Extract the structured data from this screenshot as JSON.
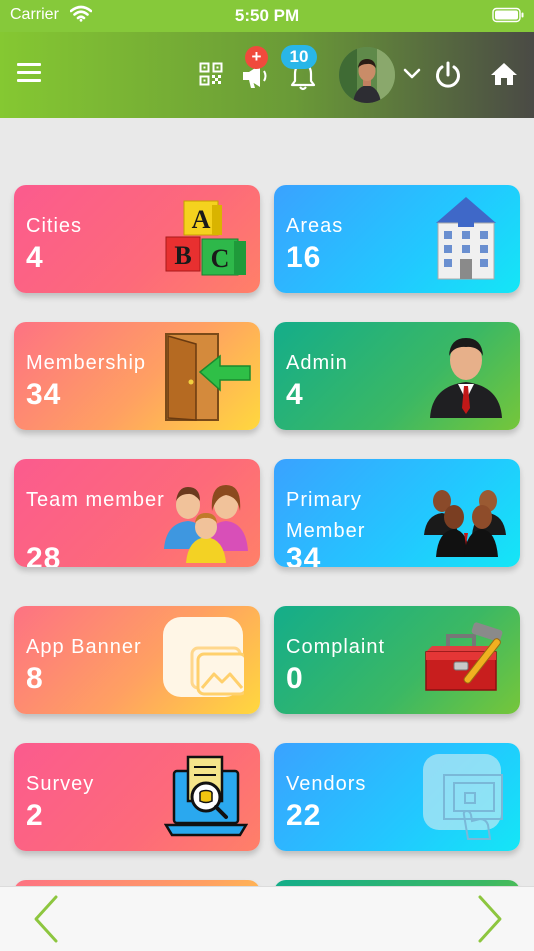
{
  "status_bar": {
    "carrier": "Carrier",
    "time": "5:50 PM"
  },
  "header": {
    "announcement_badge": "+",
    "notification_badge": "10",
    "icons": [
      "menu-icon",
      "qr-code-icon",
      "megaphone-icon",
      "bell-icon",
      "avatar",
      "chevron-down-icon",
      "power-icon",
      "home-icon"
    ]
  },
  "cards": [
    {
      "label": "Cities",
      "value": "4",
      "icon": "abc-blocks-icon"
    },
    {
      "label": "Areas",
      "value": "16",
      "icon": "building-icon"
    },
    {
      "label": "Membership",
      "value": "34",
      "icon": "door-enter-icon"
    },
    {
      "label": "Admin",
      "value": "4",
      "icon": "businessman-icon"
    },
    {
      "label": "Team member",
      "value": "28",
      "icon": "family-icon"
    },
    {
      "label": "Primary Member",
      "value": "34",
      "icon": "group-icon"
    },
    {
      "label": "App Banner",
      "value": "8",
      "icon": "image-gallery-icon"
    },
    {
      "label": "Complaint",
      "value": "0",
      "icon": "toolbox-icon"
    },
    {
      "label": "Survey",
      "value": "2",
      "icon": "survey-laptop-icon"
    },
    {
      "label": "Vendors",
      "value": "22",
      "icon": "touch-gesture-icon"
    }
  ],
  "colors": {
    "header_green": "#85c832",
    "pink": "#fb5b8e",
    "blue": "#22c8ff",
    "orange": "#ffa062",
    "green": "#3bb864",
    "nav_arrow": "#8dc63f"
  }
}
